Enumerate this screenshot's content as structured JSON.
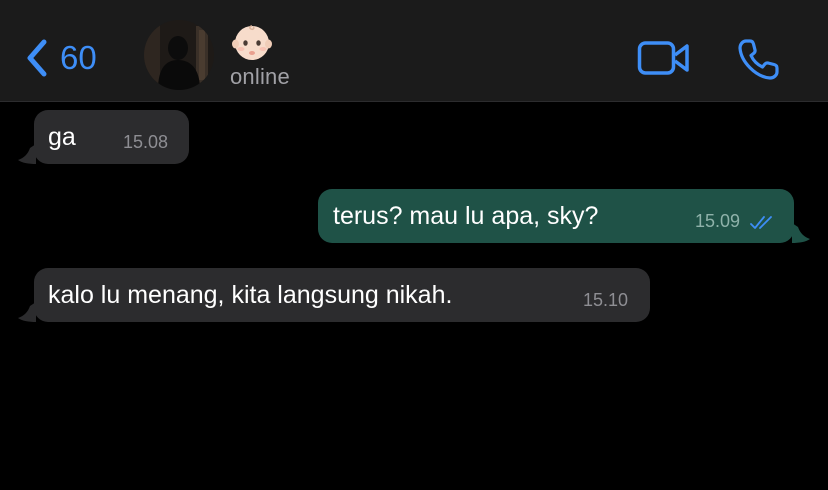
{
  "header": {
    "back_count": "60",
    "contact_emoji": "baby-face-emoji",
    "status": "online",
    "icons": {
      "back": "chevron-left-icon",
      "video": "video-camera-icon",
      "voice": "phone-icon"
    },
    "accent_color": "#3e8ef7"
  },
  "messages": [
    {
      "direction": "incoming",
      "text": "ga",
      "time": "15.08"
    },
    {
      "direction": "outgoing",
      "text": "terus? mau lu apa, sky?",
      "time": "15.09",
      "status": "read"
    },
    {
      "direction": "incoming",
      "text": "kalo lu menang, kita langsung nikah.",
      "time": "15.10"
    }
  ],
  "colors": {
    "header_bg": "#1b1b1b",
    "chat_bg": "#000000",
    "incoming_bubble": "#2c2c2e",
    "outgoing_bubble": "#1f5247",
    "read_ticks": "#3e8ef7"
  }
}
